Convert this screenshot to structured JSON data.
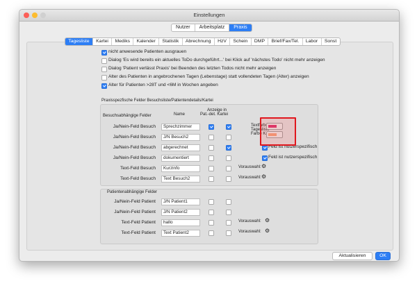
{
  "window": {
    "title": "Einstellungen"
  },
  "top_tabs": [
    {
      "label": "Nutzer",
      "active": false
    },
    {
      "label": "Arbeitsplatz",
      "active": false
    },
    {
      "label": "Praxis",
      "active": true
    }
  ],
  "sub_tabs": [
    {
      "label": "Tagesliste",
      "active": true
    },
    {
      "label": "Kartei",
      "active": false
    },
    {
      "label": "Mediks",
      "active": false
    },
    {
      "label": "Kalender",
      "active": false
    },
    {
      "label": "Statistik",
      "active": false
    },
    {
      "label": "Abrechnung",
      "active": false
    },
    {
      "label": "HzV",
      "active": false
    },
    {
      "label": "Schein",
      "active": false
    },
    {
      "label": "DMP",
      "active": false
    },
    {
      "label": "Brief/Fax/Tel.",
      "active": false
    },
    {
      "label": "Labor",
      "active": false
    },
    {
      "label": "Sonst",
      "active": false
    }
  ],
  "options": [
    {
      "label": "nicht anwesende Patienten ausgrauen",
      "checked": true
    },
    {
      "label": "Dialog 'Es wird bereits ein aktuelles ToDo durchgeführt...' bei Klick auf 'nächstes Todo' nicht mehr anzeigen",
      "checked": false
    },
    {
      "label": "Dialog 'Patient verlässt Praxis' bei Beenden des letzten Todos nicht mehr anzeigen",
      "checked": false
    },
    {
      "label": "Alter des Patienten in angebrochenen Tagen (Lebenstage) statt vollendeten Tagen (Alter) anzeigen",
      "checked": false
    },
    {
      "label": "Alter für Patienten >28T und <6M in Wochen angeben",
      "checked": true
    }
  ],
  "section": {
    "title": "Praxisspezfische Felder Besuchsliste/Patientendetails/Kartei",
    "visit_group_title": "Besuchsabhängige Felder",
    "col_name": "Name",
    "col_display_line1": "Anzeige in",
    "col_display_line2": "Pat.-det.   Kartei",
    "visit_rows": [
      {
        "label": "Ja/Nein-Feld Besuch",
        "value": "Sprechzimmer",
        "pat": true,
        "kartei": true
      },
      {
        "label": "Ja/Nein-Feld Besuch",
        "value": "J/N Besuch2",
        "pat": false,
        "kartei": false
      },
      {
        "label": "Ja/Nein-Feld Besuch",
        "value": "abgerechnet",
        "pat": false,
        "kartei": true
      },
      {
        "label": "Ja/Nein-Feld Besuch",
        "value": "dokumentiert",
        "pat": false,
        "kartei": false
      },
      {
        "label": "Text-Feld Besuch",
        "value": "Kurzinfo",
        "pat": false,
        "kartei": false
      },
      {
        "label": "Text-Feld Besuch",
        "value": "Text Besuch2",
        "pat": false,
        "kartei": false
      }
    ],
    "color_labels": [
      "Textfarbe",
      "Tagesliste",
      "Farbe Kartei"
    ],
    "colors": {
      "text": "#d6336c",
      "kartei": "#f0a07a"
    },
    "user_specific_label": "Feld ist nutzerspezifisch",
    "default_label": "Vorauswahl:",
    "patient_group_title": "Patientenabhängige Felder",
    "patient_rows": [
      {
        "label": "Ja/Nein-Feld Patient",
        "value": "J/N Patient1",
        "pat": false,
        "kartei": false
      },
      {
        "label": "Ja/Nein-Feld Patient",
        "value": "J/N Patient2",
        "pat": false,
        "kartei": false
      },
      {
        "label": "Text-Feld Patient",
        "value": "hallo",
        "pat": false,
        "kartei": false
      },
      {
        "label": "Text-Feld Patient",
        "value": "Text Patient2",
        "pat": false,
        "kartei": false
      }
    ]
  },
  "buttons": {
    "refresh": "Aktualisieren",
    "ok": "OK"
  }
}
